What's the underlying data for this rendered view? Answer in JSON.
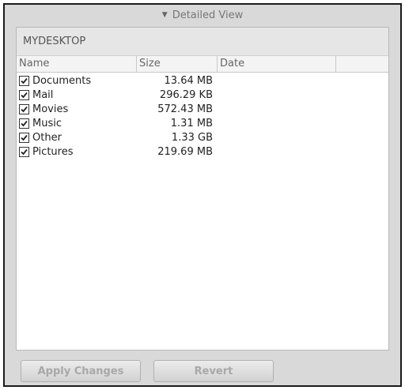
{
  "toggle": {
    "label": "Detailed View",
    "expanded": true
  },
  "device": {
    "name": "MYDESKTOP"
  },
  "columns": [
    "Name",
    "Size",
    "Date",
    ""
  ],
  "items": [
    {
      "name": "Documents",
      "size": "13.64 MB",
      "checked": true
    },
    {
      "name": "Mail",
      "size": "296.29 KB",
      "checked": true
    },
    {
      "name": "Movies",
      "size": "572.43 MB",
      "checked": true
    },
    {
      "name": "Music",
      "size": "1.31 MB",
      "checked": true
    },
    {
      "name": "Other",
      "size": "1.33 GB",
      "checked": true
    },
    {
      "name": "Pictures",
      "size": "219.69 MB",
      "checked": true
    }
  ],
  "footer": {
    "apply_label": "Apply Changes",
    "revert_label": "Revert",
    "buttons_enabled": false
  },
  "colors": {
    "panel_bg": "#d9d9d9",
    "list_bg": "#ffffff",
    "border": "#1a1a1a",
    "disabled_text": "#a8a8a8"
  }
}
